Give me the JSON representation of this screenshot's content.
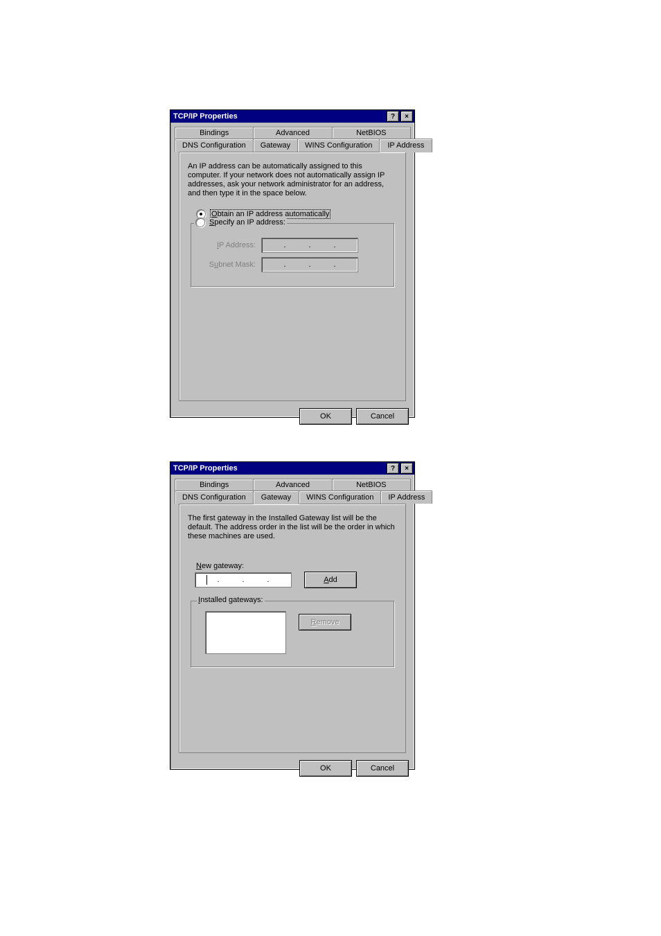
{
  "dialog1": {
    "title": "TCP/IP Properties",
    "helpGlyph": "?",
    "closeGlyph": "×",
    "tabsRow1": [
      "Bindings",
      "Advanced",
      "NetBIOS"
    ],
    "tabsRow2": [
      "DNS Configuration",
      "Gateway",
      "WINS Configuration",
      "IP Address"
    ],
    "activeTab": "IP Address",
    "desc": "An IP address can be automatically assigned to this computer. If your network does not automatically assign IP addresses, ask your network administrator for an address, and then type it in the space below.",
    "radio1": {
      "u": "O",
      "rest": "btain an IP address automatically"
    },
    "radio2": {
      "u": "S",
      "rest": "pecify an IP address:"
    },
    "ipLabel": {
      "u": "I",
      "rest": "P Address:"
    },
    "maskLabel": {
      "pre": "S",
      "u": "u",
      "rest": "bnet Mask:"
    },
    "ok": "OK",
    "cancel": "Cancel"
  },
  "dialog2": {
    "title": "TCP/IP Properties",
    "helpGlyph": "?",
    "closeGlyph": "×",
    "tabsRow1": [
      "Bindings",
      "Advanced",
      "NetBIOS"
    ],
    "tabsRow2": [
      "DNS Configuration",
      "Gateway",
      "WINS Configuration",
      "IP Address"
    ],
    "activeTab": "Gateway",
    "desc": "The first gateway in the Installed Gateway list will be the default. The address order in the list will be the order in which these machines are used.",
    "newGw": {
      "u": "N",
      "rest": "ew gateway:"
    },
    "add": {
      "u": "A",
      "rest": "dd"
    },
    "installed": {
      "u": "I",
      "rest": "nstalled gateways:"
    },
    "remove": {
      "u": "R",
      "rest": "emove"
    },
    "ok": "OK",
    "cancel": "Cancel"
  }
}
